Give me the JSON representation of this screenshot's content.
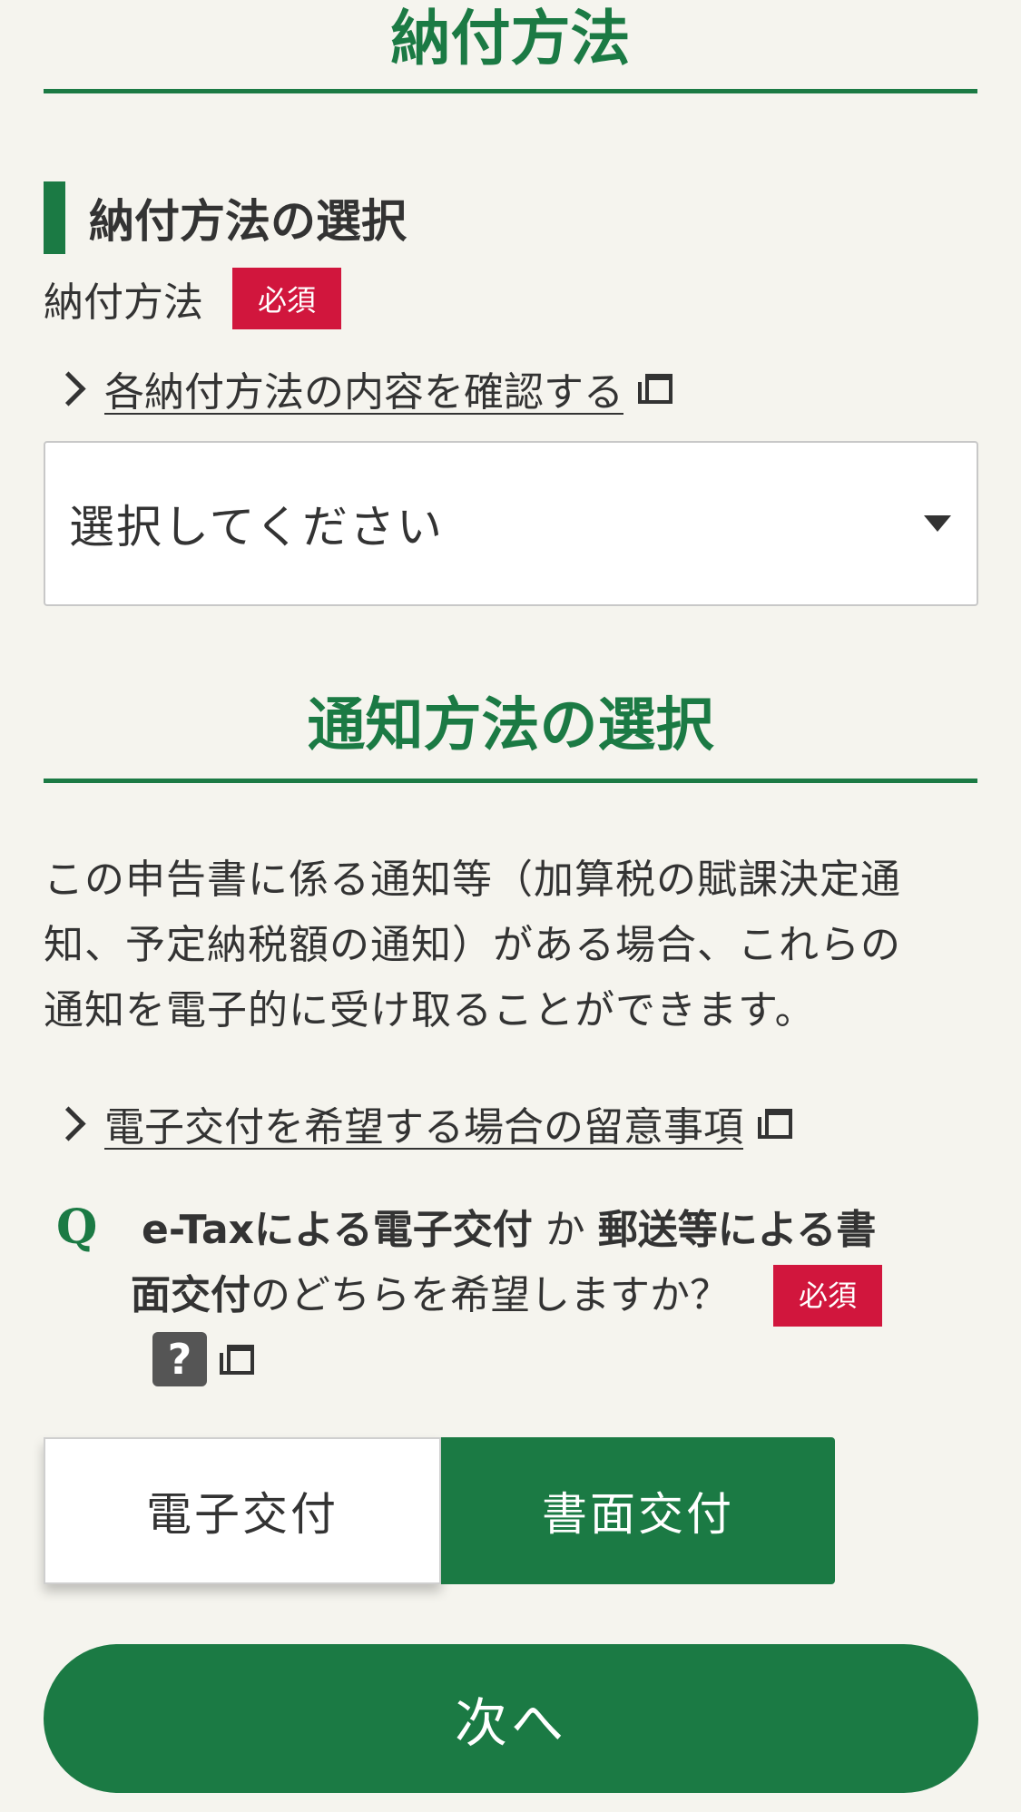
{
  "payment_section": {
    "title": "納付方法",
    "subheading": "納付方法の選択",
    "field_label": "納付方法",
    "required_badge": "必須",
    "link_text": "各納付方法の内容を確認する",
    "select": {
      "value": "選択してください"
    }
  },
  "notify_section": {
    "title": "通知方法の選択",
    "description": [
      "この申告書に係る通知等（加算税の賦課決定通",
      "知、予定納税額の通知）がある場合、これらの",
      "通知を電子的に受け取ることができます。"
    ],
    "link_text": "電子交付を希望する場合の留意事項",
    "question": {
      "mark": "Q",
      "bold1": "e-Taxによる電子交付",
      "mid": " か ",
      "bold2a": "郵送等による書",
      "bold2b": "面交付",
      "rest": " のどちらを希望しますか？",
      "required_badge": "必須",
      "help": "?"
    },
    "options": [
      "電子交付",
      "書面交付"
    ],
    "selected_option": "書面交付"
  },
  "next_button": "次へ",
  "colors": {
    "accent": "#1b7a44",
    "required": "#d1163d",
    "background": "#f5f4ee"
  },
  "icons": [
    "chevron-right-icon",
    "external-window-icon",
    "dropdown-caret-icon",
    "help-icon"
  ]
}
